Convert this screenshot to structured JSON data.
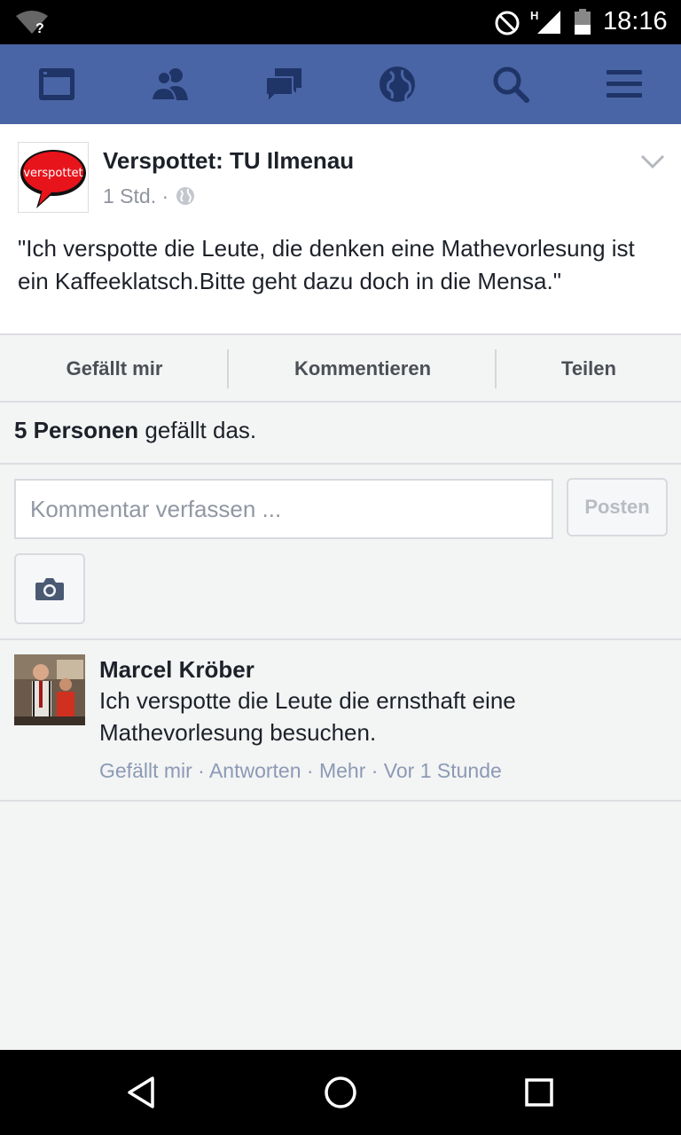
{
  "status_bar": {
    "time": "18:16",
    "network_type": "H",
    "wifi_status": "?",
    "icons": [
      "wifi-unknown-icon",
      "do-not-disturb-icon",
      "signal-icon",
      "battery-icon"
    ]
  },
  "nav": {
    "color": "#4a65a5",
    "items": [
      {
        "icon": "news-feed-icon"
      },
      {
        "icon": "friends-icon"
      },
      {
        "icon": "messages-icon"
      },
      {
        "icon": "globe-notifications-icon"
      },
      {
        "icon": "search-icon"
      },
      {
        "icon": "menu-icon"
      }
    ]
  },
  "post": {
    "page_logo_text": "verspottet",
    "page_name": "Verspottet: TU Ilmenau",
    "time": "1 Std. ·",
    "text": "\"Ich verspotte die Leute, die denken eine Mathevorlesung ist ein Kaffeeklatsch.Bitte geht dazu doch in die Mensa.\""
  },
  "actions": {
    "like": "Gefällt mir",
    "comment": "Kommentieren",
    "share": "Teilen"
  },
  "likes": {
    "count": "5 Personen",
    "suffix": " gefällt das."
  },
  "composer": {
    "placeholder": "Kommentar verfassen ...",
    "post_label": "Posten"
  },
  "comments": [
    {
      "author": "Marcel Kröber",
      "text": "Ich verspotte die Leute die ernsthaft eine Mathevorlesung besuchen.",
      "actions": "Gefällt mir · Antworten · Mehr · Vor 1 Stunde"
    }
  ],
  "system_nav": {
    "icons": [
      "back-icon",
      "home-icon",
      "recents-icon"
    ]
  }
}
